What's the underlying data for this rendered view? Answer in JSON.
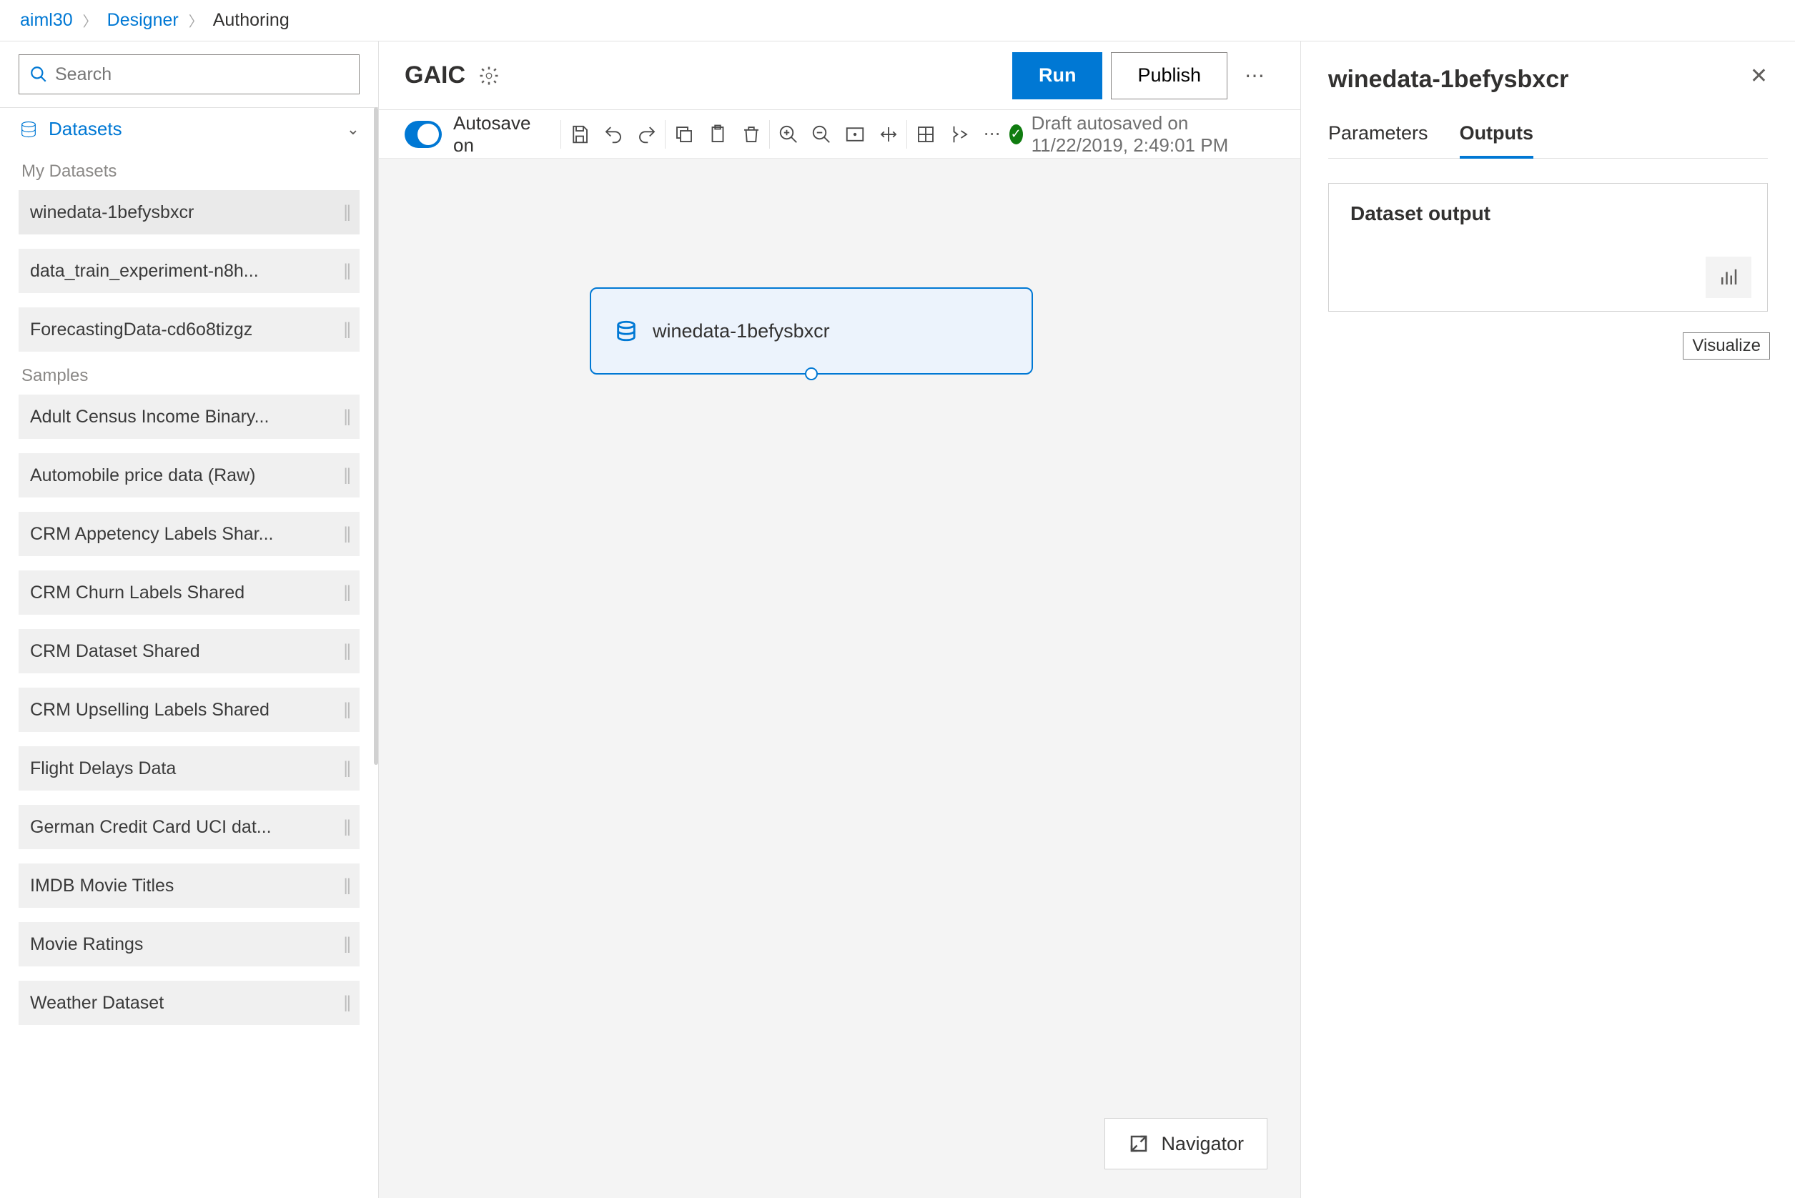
{
  "breadcrumb": {
    "workspace": "aiml30",
    "designer": "Designer",
    "page": "Authoring"
  },
  "search": {
    "placeholder": "Search"
  },
  "palette": {
    "section_label": "Datasets",
    "groups": [
      {
        "label": "My Datasets",
        "items": [
          {
            "name": "winedata-1befysbxcr",
            "selected": true
          },
          {
            "name": "data_train_experiment-n8h..."
          },
          {
            "name": "ForecastingData-cd6o8tizgz"
          }
        ]
      },
      {
        "label": "Samples",
        "items": [
          {
            "name": "Adult Census Income Binary..."
          },
          {
            "name": "Automobile price data (Raw)"
          },
          {
            "name": "CRM Appetency Labels Shar..."
          },
          {
            "name": "CRM Churn Labels Shared"
          },
          {
            "name": "CRM Dataset Shared"
          },
          {
            "name": "CRM Upselling Labels Shared"
          },
          {
            "name": "Flight Delays Data"
          },
          {
            "name": "German Credit Card UCI dat..."
          },
          {
            "name": "IMDB Movie Titles"
          },
          {
            "name": "Movie Ratings"
          },
          {
            "name": "Weather Dataset"
          }
        ]
      }
    ]
  },
  "header": {
    "pipeline_name": "GAIC",
    "run": "Run",
    "publish": "Publish"
  },
  "toolbar": {
    "autosave_label": "Autosave on",
    "status_text": "Draft autosaved on 11/22/2019, 2:49:01 PM"
  },
  "node": {
    "label": "winedata-1befysbxcr"
  },
  "navigator": {
    "label": "Navigator"
  },
  "props": {
    "title": "winedata-1befysbxcr",
    "tabs": {
      "parameters": "Parameters",
      "outputs": "Outputs"
    },
    "output_card_title": "Dataset output",
    "visualize_tooltip": "Visualize"
  }
}
